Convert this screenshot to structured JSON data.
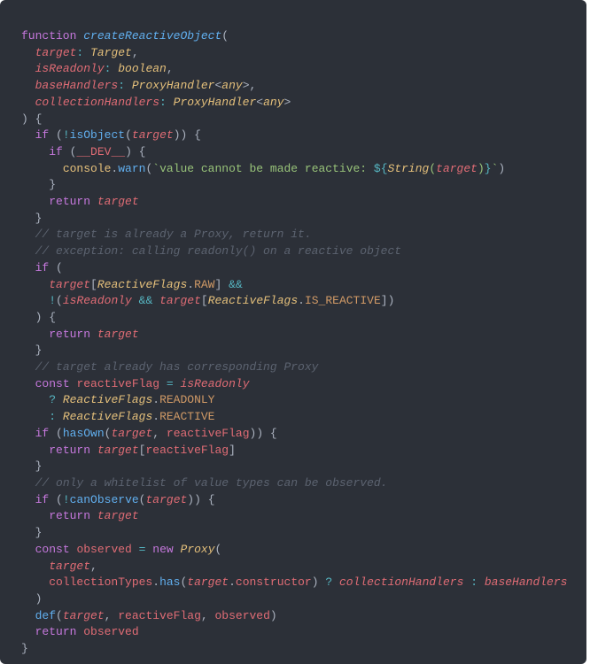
{
  "code": {
    "l1_fn": "function",
    "l1_name": "createReactiveObject",
    "l1_paren": "(",
    "l2_p": "target",
    "l2_t": "Target",
    "l3_p": "isReadonly",
    "l3_t": "boolean",
    "l4_p": "baseHandlers",
    "l4_t": "ProxyHandler",
    "l4_any": "any",
    "l5_p": "collectionHandlers",
    "l5_t": "ProxyHandler",
    "l5_any": "any",
    "l6": ") {",
    "l7_if": "if",
    "l7_not": "!",
    "l7_fn": "isObject",
    "l7_arg": "target",
    "l8_if": "if",
    "l8_dev": "__DEV__",
    "l9_console": "console",
    "l9_warn": "warn",
    "l9_str1": "`value cannot be made reactive: ",
    "l9_dollar": "${",
    "l9_string": "String",
    "l9_target": "target",
    "l9_close": "}",
    "l9_tick": "`",
    "l10_close": "}",
    "l11_ret": "return",
    "l11_target": "target",
    "l12_close": "}",
    "l13_cmt": "// target is already a Proxy, return it.",
    "l14_cmt": "// exception: calling readonly() on a reactive object",
    "l15_if": "if",
    "l16_target": "target",
    "l16_rf": "ReactiveFlags",
    "l16_raw": "RAW",
    "l16_and": "&&",
    "l17_not": "!",
    "l17_iro": "isReadonly",
    "l17_and": "&&",
    "l17_target": "target",
    "l17_rf": "ReactiveFlags",
    "l17_isr": "IS_REACTIVE",
    "l18": ") {",
    "l19_ret": "return",
    "l19_target": "target",
    "l20_close": "}",
    "l21_cmt": "// target already has corresponding Proxy",
    "l22_const": "const",
    "l22_rf": "reactiveFlag",
    "l22_eq": "=",
    "l22_iro": "isReadonly",
    "l23_q": "?",
    "l23_rf": "ReactiveFlags",
    "l23_ro": "READONLY",
    "l24_c": ":",
    "l24_rf": "ReactiveFlags",
    "l24_re": "REACTIVE",
    "l25_if": "if",
    "l25_ho": "hasOwn",
    "l25_target": "target",
    "l25_rf": "reactiveFlag",
    "l26_ret": "return",
    "l26_target": "target",
    "l26_rf": "reactiveFlag",
    "l27_close": "}",
    "l28_cmt": "// only a whitelist of value types can be observed.",
    "l29_if": "if",
    "l29_not": "!",
    "l29_co": "canObserve",
    "l29_target": "target",
    "l30_ret": "return",
    "l30_target": "target",
    "l31_close": "}",
    "l32_const": "const",
    "l32_obs": "observed",
    "l32_eq": "=",
    "l32_new": "new",
    "l32_proxy": "Proxy",
    "l33_target": "target",
    "l34_ct": "collectionTypes",
    "l34_has": "has",
    "l34_target": "target",
    "l34_con": "constructor",
    "l34_q": "?",
    "l34_ch": "collectionHandlers",
    "l34_c": ":",
    "l34_bh": "baseHandlers",
    "l35_close": ")",
    "l36_def": "def",
    "l36_target": "target",
    "l36_rf": "reactiveFlag",
    "l36_obs": "observed",
    "l37_ret": "return",
    "l37_obs": "observed",
    "l38_close": "}"
  }
}
